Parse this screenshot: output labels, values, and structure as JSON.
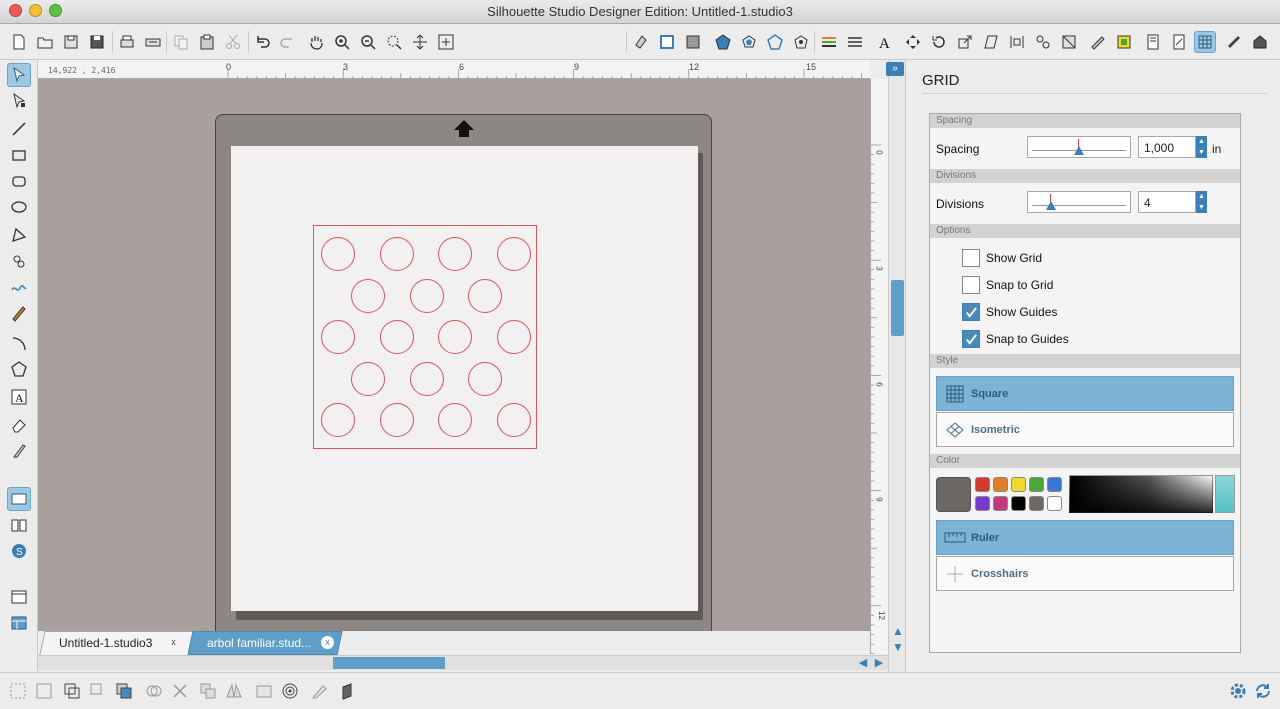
{
  "window": {
    "title": "Silhouette Studio Designer Edition: Untitled-1.studio3"
  },
  "canvas": {
    "coordinates": "14,922 , 2,416",
    "ruler_h": [
      "0",
      "3",
      "6",
      "9",
      "12",
      "15"
    ],
    "ruler_v": [
      "0",
      "3",
      "6",
      "9",
      "12"
    ]
  },
  "tabs": [
    {
      "label": "Untitled-1.studio3",
      "close": "x"
    },
    {
      "label": "arbol familiar.stud...",
      "close": "x"
    }
  ],
  "panel": {
    "title": "GRID",
    "spacing_section": "Spacing",
    "spacing_label": "Spacing",
    "spacing_value": "1,000",
    "spacing_unit": "in",
    "divisions_section": "Divisions",
    "divisions_label": "Divisions",
    "divisions_value": "4",
    "options_section": "Options",
    "options": [
      {
        "label": "Show Grid",
        "checked": false
      },
      {
        "label": "Snap to Grid",
        "checked": false
      },
      {
        "label": "Show Guides",
        "checked": true
      },
      {
        "label": "Snap to Guides",
        "checked": true
      }
    ],
    "style_section": "Style",
    "style_square": "Square",
    "style_isometric": "Isometric",
    "color_section": "Color",
    "color_current": "#6e6865",
    "swatch_colors": [
      "#d23a2b",
      "#e0802a",
      "#efd92e",
      "#4aa83a",
      "#3a77d4",
      "#7a3ac9",
      "#c23a7a",
      "#000000",
      "#6e6865",
      "#ffffff"
    ],
    "ruler_option": "Ruler",
    "crosshairs_option": "Crosshairs"
  },
  "colors": {
    "accent": "#5f9ec8",
    "design_stroke": "#d9555e",
    "workspace": "#a7a09d",
    "mat": "#8d8783"
  }
}
